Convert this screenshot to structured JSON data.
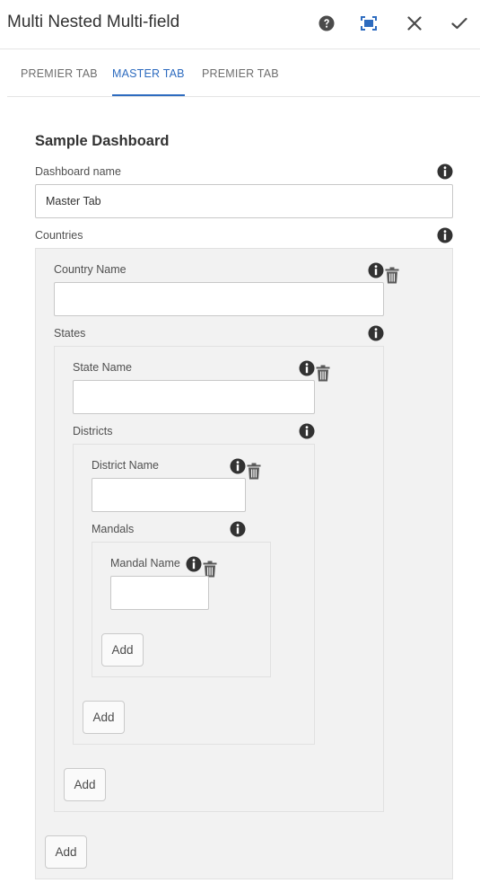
{
  "dialog": {
    "title": "Multi Nested Multi-field",
    "icons": {
      "help": "help-icon",
      "fullscreen": "fullscreen-icon",
      "close": "close-icon",
      "done": "check-icon"
    }
  },
  "tabs": [
    {
      "label": "PREMIER TAB",
      "active": false
    },
    {
      "label": "MASTER TAB",
      "active": true
    },
    {
      "label": "PREMIER TAB",
      "active": false
    }
  ],
  "form": {
    "heading": "Sample Dashboard",
    "dashboard_name": {
      "label": "Dashboard name",
      "value": "Master Tab"
    },
    "countries": {
      "label": "Countries",
      "country_name": {
        "label": "Country Name",
        "value": ""
      },
      "states": {
        "label": "States",
        "state_name": {
          "label": "State Name",
          "value": ""
        },
        "districts": {
          "label": "Districts",
          "district_name": {
            "label": "District Name",
            "value": ""
          },
          "mandals": {
            "label": "Mandals",
            "mandal_name": {
              "label": "Mandal Name",
              "value": ""
            },
            "add_label": "Add"
          },
          "add_label": "Add"
        },
        "add_label": "Add"
      },
      "add_label": "Add"
    }
  },
  "colors": {
    "accent": "#2d6bbf",
    "panel_bg": "#f2f2f2",
    "icon": "#4b4b4b"
  }
}
